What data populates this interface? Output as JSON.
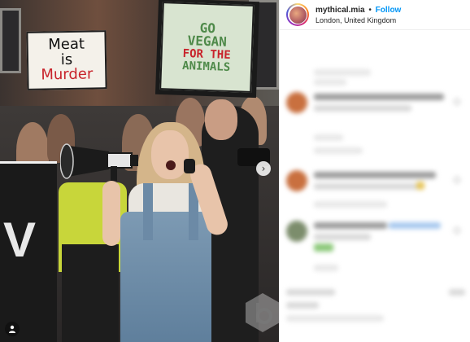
{
  "post": {
    "username": "mythical.mia",
    "separator": "•",
    "follow_label": "Follow",
    "location": "London, United Kingdom"
  },
  "photo": {
    "sign_left": {
      "line1": "Meat",
      "line2": "is",
      "line3": "Murder"
    },
    "sign_right": {
      "line1": "GO",
      "line2": "VEGAN",
      "line3": "FOR THE",
      "line4": "ANIMALS"
    },
    "banner_letter": "V",
    "next_arrow": "›"
  },
  "colors": {
    "follow_blue": "#0095f6",
    "sign_red": "#c8232b",
    "sign_green": "#4f8a4a"
  },
  "icons": {
    "user_tag": "person-icon",
    "next": "chevron-right-icon",
    "watermark": "watermark-logo-icon"
  }
}
